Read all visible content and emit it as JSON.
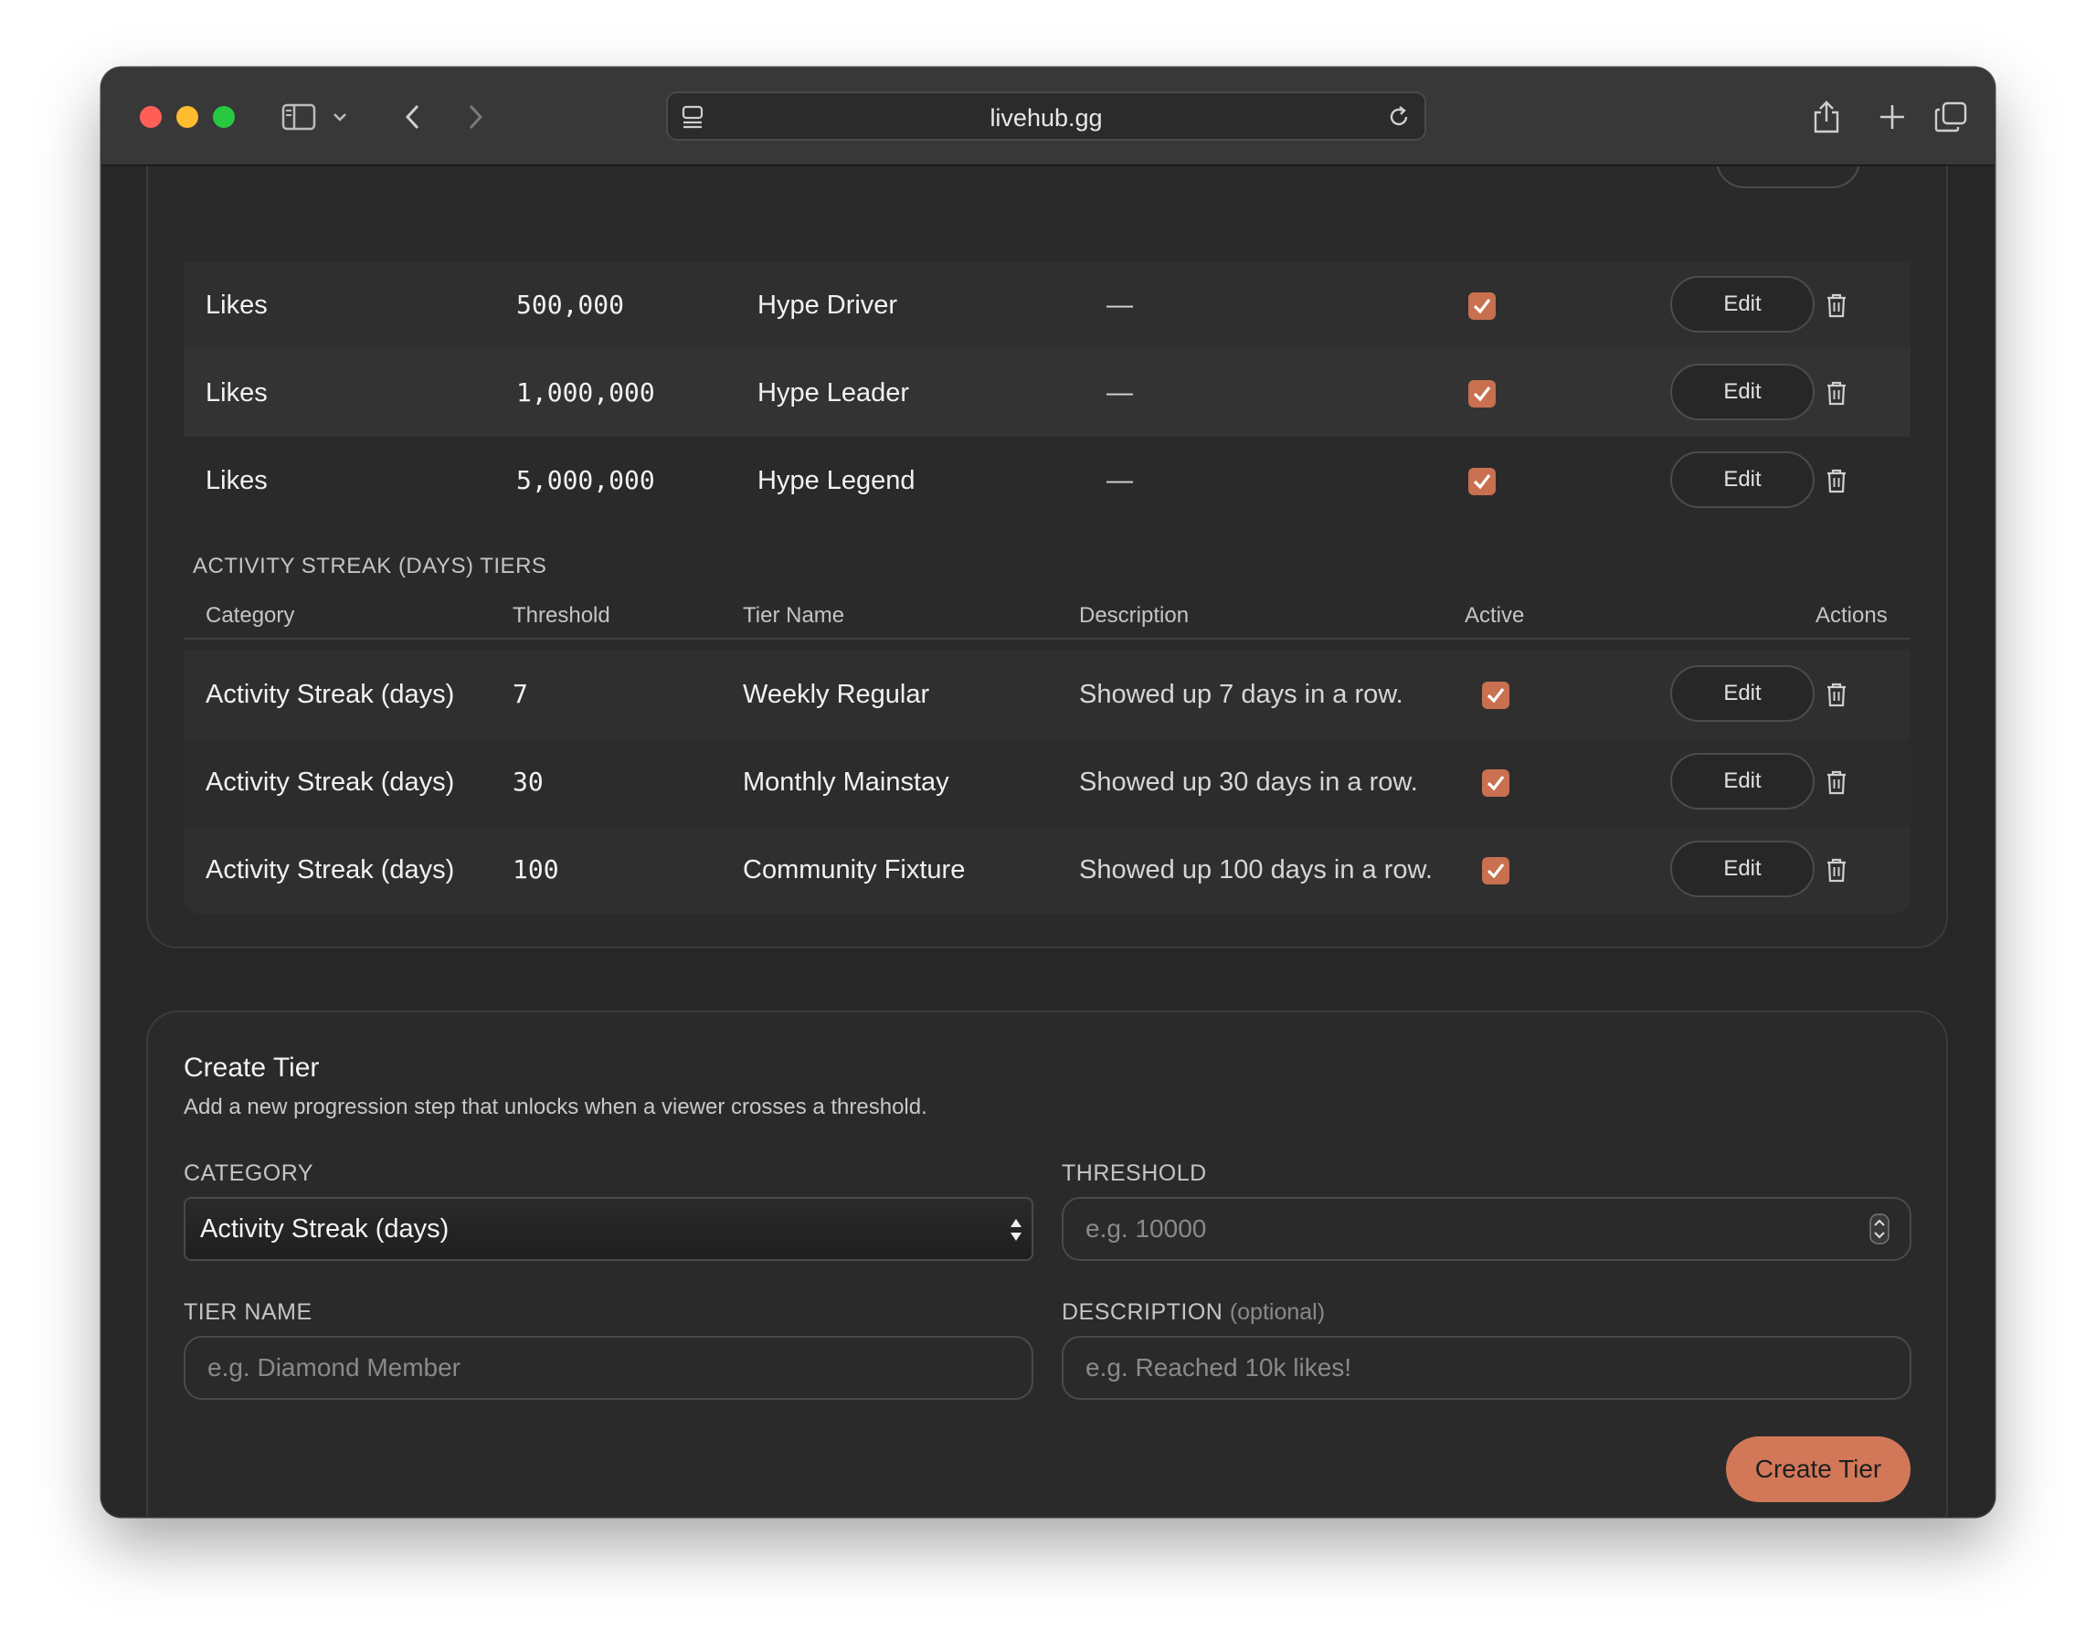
{
  "browser": {
    "url": "livehub.gg"
  },
  "likes_rows": [
    {
      "category": "Likes",
      "threshold": "500,000",
      "tier_name": "Hype Driver",
      "description": "—",
      "edit": "Edit"
    },
    {
      "category": "Likes",
      "threshold": "1,000,000",
      "tier_name": "Hype Leader",
      "description": "—",
      "edit": "Edit"
    },
    {
      "category": "Likes",
      "threshold": "5,000,000",
      "tier_name": "Hype Legend",
      "description": "—",
      "edit": "Edit"
    }
  ],
  "streak": {
    "section_title": "ACTIVITY STREAK (DAYS) TIERS",
    "headers": {
      "category": "Category",
      "threshold": "Threshold",
      "tier_name": "Tier Name",
      "description": "Description",
      "active": "Active",
      "actions": "Actions"
    },
    "rows": [
      {
        "category": "Activity Streak (days)",
        "threshold": "7",
        "tier_name": "Weekly Regular",
        "description": "Showed up 7 days in a row.",
        "edit": "Edit"
      },
      {
        "category": "Activity Streak (days)",
        "threshold": "30",
        "tier_name": "Monthly Mainstay",
        "description": "Showed up 30 days in a row.",
        "edit": "Edit"
      },
      {
        "category": "Activity Streak (days)",
        "threshold": "100",
        "tier_name": "Community Fixture",
        "description": "Showed up 100 days in a row.",
        "edit": "Edit"
      }
    ]
  },
  "create_form": {
    "title": "Create Tier",
    "subtitle": "Add a new progression step that unlocks when a viewer crosses a threshold.",
    "category_label": "CATEGORY",
    "category_value": "Activity Streak (days)",
    "threshold_label": "THRESHOLD",
    "threshold_placeholder": "e.g. 10000",
    "tier_name_label": "TIER NAME",
    "tier_name_placeholder": "e.g. Diamond Member",
    "description_label": "DESCRIPTION",
    "description_optional": "(optional)",
    "description_placeholder": "e.g. Reached 10k likes!",
    "submit_label": "Create Tier"
  },
  "colors": {
    "accent": "#d27859",
    "checkbox": "#c8704f",
    "background": "#272727"
  }
}
